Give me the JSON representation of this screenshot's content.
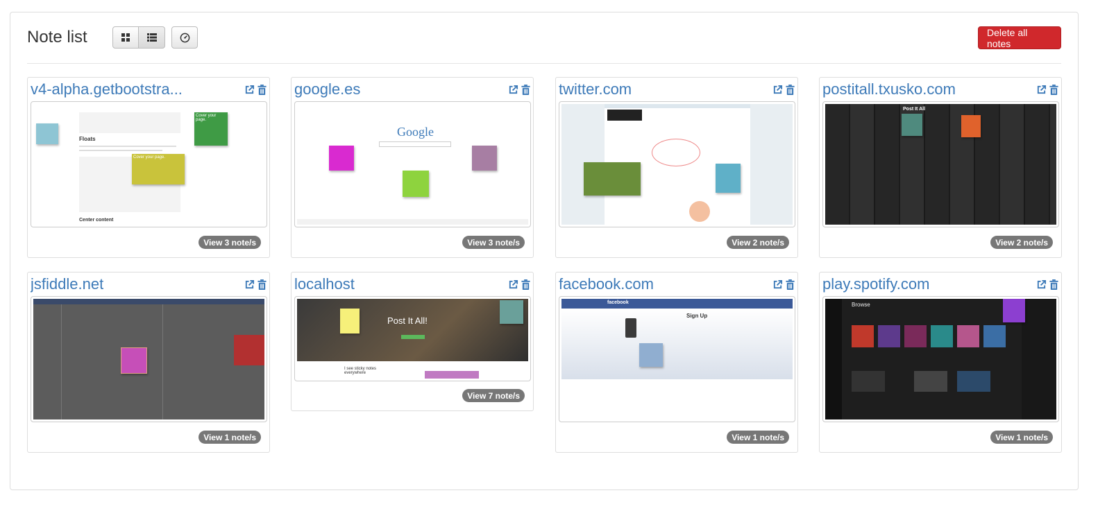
{
  "header": {
    "title": "Note list",
    "delete_all_label": "Delete all notes"
  },
  "view_buttons": [
    {
      "icon": "grid-icon"
    },
    {
      "icon": "list-icon"
    },
    {
      "icon": "dashboard-icon"
    }
  ],
  "colors": {
    "link": "#3d7ab8",
    "danger": "#d0282c",
    "badge": "#777777"
  },
  "cards": [
    {
      "title": "v4-alpha.getbootstra...",
      "badge": "View 3 note/s",
      "thumb_text": {
        "a": "Floats",
        "b": "Center content",
        "c": "Cover your page.",
        "d": "Cover your page."
      }
    },
    {
      "title": "google.es",
      "badge": "View 3 note/s",
      "thumb_text": {
        "a": "Google"
      }
    },
    {
      "title": "twitter.com",
      "badge": "View 2 note/s"
    },
    {
      "title": "postitall.txusko.com",
      "badge": "View 2 note/s",
      "thumb_text": {
        "a": "Post It All"
      }
    },
    {
      "title": "jsfiddle.net",
      "badge": "View 1 note/s"
    },
    {
      "title": "localhost",
      "badge": "View 7 note/s",
      "thumb_text": {
        "a": "Post It All!",
        "b": "I see sticky notes everywhere"
      }
    },
    {
      "title": "facebook.com",
      "badge": "View 1 note/s",
      "thumb_text": {
        "a": "facebook",
        "b": "Sign Up"
      }
    },
    {
      "title": "play.spotify.com",
      "badge": "View 1 note/s",
      "thumb_text": {
        "a": "Browse"
      }
    }
  ]
}
